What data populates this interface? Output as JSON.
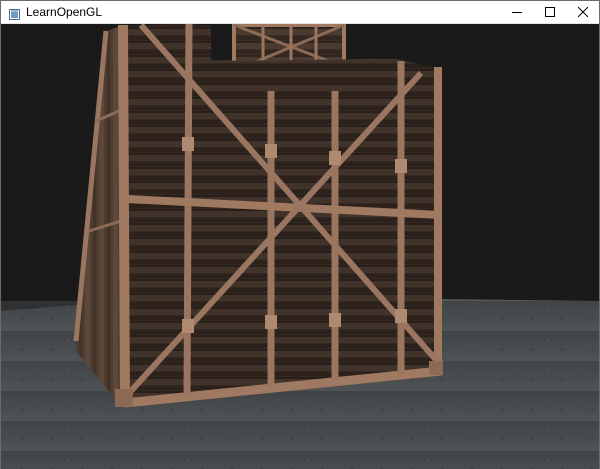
{
  "window": {
    "title": "LearnOpenGL",
    "app_icon": "opengl-window-icon",
    "controls": {
      "minimize_icon": "minimize-icon",
      "maximize_icon": "maximize-icon",
      "close_icon": "close-icon"
    }
  },
  "scene": {
    "description_objects": [
      "wooden-crate-large",
      "wooden-crate-small",
      "concrete-floor"
    ],
    "colors": {
      "background": "#1a1a1a",
      "floor": "#4a4d50",
      "wood_dark": "#3b2e27",
      "wood_light": "#8c6a55",
      "frame": "#a07a60"
    }
  }
}
